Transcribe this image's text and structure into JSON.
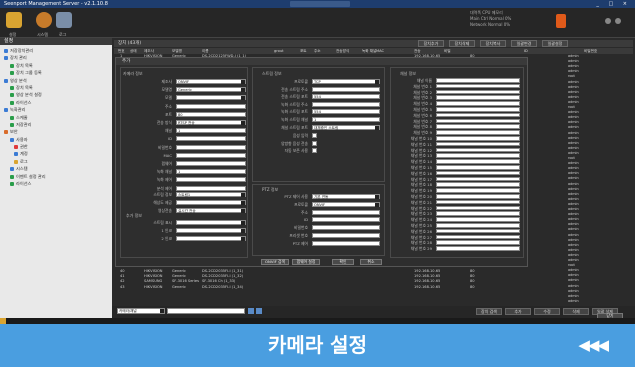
{
  "app": {
    "title": "Seenport Management Server - v2.1.10.8",
    "window_controls": "_ □ ×"
  },
  "toolbar": {
    "items": [
      {
        "label": "설정"
      },
      {
        "label": "시스템"
      },
      {
        "label": "로그"
      }
    ]
  },
  "topright": {
    "line1": "대역폭  CPU  메모리",
    "line2": "Main Ctrl  Normal  0%",
    "line3": "Network  Normal  0%"
  },
  "sidebar": {
    "header": "설정",
    "items": [
      {
        "label": "저장장치관리"
      },
      {
        "label": "장치 관리"
      },
      {
        "label": "장치 목록"
      },
      {
        "label": "장치 그룹 등록"
      },
      {
        "label": "영상 분석"
      },
      {
        "label": "장치 목록"
      },
      {
        "label": "영상 분석 설정"
      },
      {
        "label": "라이선스"
      },
      {
        "label": "녹화관리"
      },
      {
        "label": "스케줄"
      },
      {
        "label": "저장관리"
      },
      {
        "label": "보안"
      },
      {
        "label": "사용자"
      },
      {
        "label": "권한"
      },
      {
        "label": "계정"
      },
      {
        "label": "로그"
      },
      {
        "label": "시스템"
      },
      {
        "label": "이벤트 설정 관리"
      },
      {
        "label": "라이선스"
      }
    ]
  },
  "main": {
    "header": "장치 (43개)",
    "top_buttons": [
      "장치추가",
      "장치삭제",
      "장치복사",
      "일괄변경",
      "일괄설정"
    ],
    "columns": [
      "번호",
      "상태",
      "제조사",
      "모델명",
      "이름",
      "grout",
      "포트",
      "주소",
      "전송방식",
      "녹화 채널",
      "MAC",
      "전송",
      "비밀",
      "ID",
      "비밀번호"
    ],
    "rows_top": [
      {
        "no": "1",
        "maker": "HIKVISION",
        "model": "Generic",
        "name": "DS-2CD2125FWD-I (1_1)",
        "ip": "192.168.10.65",
        "port": "80",
        "user": "admin"
      }
    ],
    "rows_bottom": [
      {
        "no": "40",
        "maker": "HIKVISION",
        "model": "Generic",
        "name": "DS-2CD2035FI-I (1_31)",
        "ip": "192.168.10.65",
        "port": "80",
        "user": "admin"
      },
      {
        "no": "41",
        "maker": "HIKVISION",
        "model": "Generic",
        "name": "DS-2CD2035FI-I (1_32)",
        "ip": "192.168.10.65",
        "port": "80",
        "user": "admin"
      },
      {
        "no": "42",
        "maker": "SAMSUNG",
        "model": "SF-3016 Series",
        "name": "SF-3016 Ch (1_33)",
        "ip": "192.168.10.65",
        "port": "80",
        "user": "admin"
      },
      {
        "no": "43",
        "maker": "HIKVISION",
        "model": "Generic",
        "name": "DS-2CD2035FI-I (1_34)",
        "ip": "192.168.10.65",
        "port": "80",
        "user": "admin"
      }
    ],
    "user_col": [
      "admin",
      "admin",
      "admin",
      "admin",
      "root",
      "admin",
      "admin",
      "admin",
      "admin",
      "admin",
      "root",
      "admin",
      "admin",
      "admin",
      "admin",
      "admin",
      "admin",
      "admin",
      "admin",
      "admin",
      "root",
      "admin",
      "admin",
      "admin",
      "admin",
      "admin",
      "admin",
      "admin",
      "admin",
      "admin",
      "admin",
      "admin",
      "admin",
      "admin",
      "admin",
      "admin",
      "admin",
      "admin",
      "admin",
      "admin",
      "admin",
      "root",
      "admin",
      "admin",
      "admin",
      "admin",
      "admin",
      "admin",
      "admin",
      "admin"
    ],
    "bottom_filter": "카메라/채널",
    "bottom_buttons": [
      "장치 검색",
      "추가",
      "수정",
      "삭제",
      "일괄 삭제"
    ],
    "close_button": "닫기"
  },
  "dialog": {
    "title": "추가",
    "camera_group": "카메라 정보",
    "camera_fields": [
      {
        "label": "제조사",
        "value": "ONVIF"
      },
      {
        "label": "모델명",
        "value": "Generic"
      },
      {
        "label": "모델",
        "value": ""
      },
      {
        "label": "주소",
        "value": ""
      },
      {
        "label": "포트",
        "value": "80"
      },
      {
        "label": "전송 방식",
        "value": "RTSP 전송"
      },
      {
        "label": "채널",
        "value": "1"
      },
      {
        "label": "ID",
        "value": ""
      },
      {
        "label": "비밀번호",
        "value": ""
      },
      {
        "label": "MAC",
        "value": ""
      },
      {
        "label": "펌웨어",
        "value": ""
      },
      {
        "label": "녹화 채널",
        "value": "1"
      },
      {
        "label": "녹화 제어",
        "value": ""
      },
      {
        "label": "분석 제어",
        "value": ""
      }
    ],
    "camera_dd": [
      {
        "label": "스트림 정보",
        "value": "스트림1"
      },
      {
        "label": "해상도 제공",
        "value": ""
      },
      {
        "label": "영상전송",
        "value": "실시간 전송"
      }
    ],
    "extra_group": "추가 정보",
    "extra_fields": [
      {
        "label": "스트림 표시"
      },
      {
        "label": "1 인코"
      },
      {
        "label": "2 인코"
      }
    ],
    "stream_group": "스트림 정보",
    "stream_fields": [
      {
        "label": "프로토콜",
        "value": "TCP"
      },
      {
        "label": "전송 스트림 주소",
        "value": ""
      },
      {
        "label": "전송 스트림 포트",
        "value": "554"
      },
      {
        "label": "녹화 스트림 주소",
        "value": ""
      },
      {
        "label": "녹화 스트림 포트",
        "value": "554"
      },
      {
        "label": "녹화 스트림 채널",
        "value": "1"
      },
      {
        "label": "채널 스트림 포트",
        "value": "대체중인 스트림"
      }
    ],
    "stream_checks": [
      {
        "label": "음성 입력"
      },
      {
        "label": "양방향 음성 전송"
      },
      {
        "label": "자동 보존 사용"
      }
    ],
    "ptz_group": "PTZ 정보",
    "ptz_fields": [
      {
        "label": "PTZ 제어 사용",
        "value": "기본 연동"
      },
      {
        "label": "프로토콜",
        "value": "ONVIF"
      },
      {
        "label": "주소",
        "value": ""
      },
      {
        "label": "ID",
        "value": ""
      },
      {
        "label": "비밀번호",
        "value": ""
      },
      {
        "label": "프리셋 번호",
        "value": ""
      },
      {
        "label": "PTZ 제어",
        "value": ""
      }
    ],
    "right_group": "채널 정보",
    "right_labels": [
      "채널 이름",
      "채널 번호 1",
      "채널 번호 2",
      "채널 번호 3",
      "채널 번호 4",
      "채널 번호 5",
      "채널 번호 6",
      "채널 번호 7",
      "채널 번호 8",
      "채널 번호 9",
      "채널 번호 10",
      "채널 번호 11",
      "채널 번호 12",
      "채널 번호 13",
      "채널 번호 14",
      "채널 번호 15",
      "채널 번호 16",
      "채널 번호 17",
      "채널 번호 18",
      "채널 번호 19",
      "채널 번호 20",
      "채널 번호 21",
      "채널 번호 22",
      "채널 번호 23",
      "채널 번호 24",
      "채널 번호 25",
      "채널 번호 26",
      "채널 번호 27",
      "채널 번호 28",
      "채널 번호 29"
    ],
    "buttons": [
      "ONVIF 검색",
      "펌웨어 설정",
      "확인",
      "취소"
    ]
  },
  "banner": {
    "title": "카메라 설정",
    "arrows": "◀◀◀"
  }
}
